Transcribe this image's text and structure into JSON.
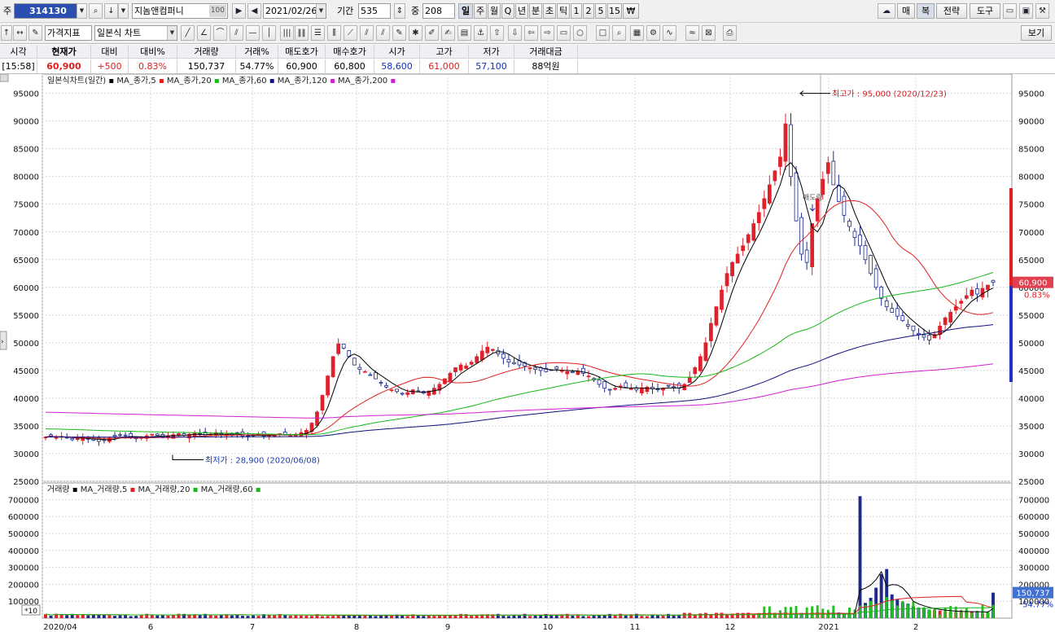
{
  "toolbar": {
    "code_prefix": "주",
    "stock_code": "314130",
    "stock_name": "지놈앤컴퍼니",
    "name_badge": "100",
    "date": "2021/02/26",
    "period_label": "기간",
    "period_value": "535",
    "zoom_label": "중",
    "zoom_value": "208",
    "periods": [
      "일",
      "주",
      "월",
      "Q",
      "년",
      "분",
      "초",
      "틱",
      "1",
      "2",
      "5",
      "15",
      "₩"
    ],
    "right_buttons": [
      "매",
      "복",
      "전략",
      "도구"
    ],
    "row2_dropdown1": "가격지표",
    "row2_dropdown2": "일본식 차트",
    "view_button": "보기"
  },
  "quote": {
    "headers": [
      "시각",
      "현재가",
      "대비",
      "대비%",
      "거래량",
      "거래%",
      "매도호가",
      "매수호가",
      "시가",
      "고가",
      "저가",
      "거래대금"
    ],
    "values": [
      "[15:58]",
      "60,900",
      "+500",
      "0.83%",
      "150,737",
      "54.77%",
      "60,900",
      "60,800",
      "58,600",
      "61,000",
      "57,100",
      "88억원"
    ]
  },
  "price_panel": {
    "legend_title": "일본식차트(일간)",
    "legend_items": [
      {
        "name": "MA_종가,5",
        "color": "#000000"
      },
      {
        "name": "MA_종가,20",
        "color": "#e02020"
      },
      {
        "name": "MA_종가,60",
        "color": "#18b818"
      },
      {
        "name": "MA_종가,120",
        "color": "#101080"
      },
      {
        "name": "MA_종가,200",
        "color": "#d020d0"
      }
    ],
    "high_annotation": "최고가 : 95,000 (2020/12/23)",
    "low_annotation": "최저가 : 28,900 (2020/06/08)",
    "mid_annotation": "매도량",
    "last_price_tag": "60,900",
    "last_change_tag": "0.83%"
  },
  "volume_panel": {
    "legend_title": "거래량",
    "legend_items": [
      {
        "name": "MA_거래량,5",
        "color": "#000000"
      },
      {
        "name": "MA_거래량,20",
        "color": "#e02020"
      },
      {
        "name": "MA_거래량,60",
        "color": "#18b818"
      }
    ],
    "scale_badge": "*10",
    "last_volume_tag": "150,737",
    "last_ratio_tag": "54.77%"
  },
  "x_axis_labels": [
    "2020/04",
    "6",
    "7",
    "8",
    "9",
    "10",
    "11",
    "12",
    "2021",
    "2"
  ],
  "chart_data": {
    "type": "candlestick",
    "title": "일본식차트(일간)",
    "price_ylim": [
      25000,
      97000
    ],
    "price_yticks": [
      25000,
      30000,
      35000,
      40000,
      45000,
      50000,
      55000,
      60000,
      65000,
      70000,
      75000,
      80000,
      85000,
      90000,
      95000
    ],
    "volume_ylim": [
      0,
      750000
    ],
    "volume_yticks": [
      100000,
      200000,
      300000,
      400000,
      500000,
      600000,
      700000
    ],
    "high": {
      "value": 95000,
      "date": "2020/12/23"
    },
    "low": {
      "value": 28900,
      "date": "2020/06/08"
    },
    "last_close": 60900,
    "close_series_approx": [
      33000,
      33200,
      32900,
      33100,
      32800,
      32500,
      32700,
      33000,
      32600,
      32400,
      32200,
      32500,
      32800,
      33100,
      33400,
      33200,
      32900,
      32700,
      32900,
      33200,
      33500,
      33300,
      33000,
      33100,
      33400,
      33600,
      33300,
      33500,
      33700,
      33400,
      33200,
      33500,
      33800,
      33600,
      33400,
      33300,
      33500,
      33200,
      33100,
      33300,
      33500,
      33200,
      33400,
      33300,
      33600,
      33400,
      33200,
      33500,
      33800,
      34200,
      35500,
      37500,
      40500,
      44000,
      47500,
      49800,
      49000,
      47500,
      46000,
      45200,
      44800,
      44200,
      43500,
      42800,
      42000,
      41500,
      41200,
      40800,
      41000,
      41500,
      41200,
      40900,
      41300,
      41800,
      42500,
      43500,
      44500,
      45500,
      46000,
      45800,
      46500,
      47500,
      48500,
      49200,
      48800,
      48000,
      47200,
      46500,
      46200,
      46000,
      45800,
      45500,
      45200,
      45000,
      44800,
      45100,
      45300,
      45000,
      44800,
      44600,
      44800,
      44500,
      44000,
      43300,
      42500,
      41800,
      41500,
      41800,
      42200,
      42000,
      41700,
      41500,
      41800,
      42000,
      41700,
      41500,
      41800,
      42200,
      42000,
      41800,
      42500,
      43800,
      45500,
      47500,
      50000,
      53500,
      56500,
      59500,
      62500,
      64500,
      66000,
      67500,
      69500,
      71500,
      73500,
      76000,
      78500,
      81000,
      83500,
      89500,
      80000,
      72000,
      66000,
      64500,
      71500,
      76000,
      79500,
      82500,
      78500,
      75500,
      73000,
      71000,
      69000,
      67500,
      65000,
      62500,
      60000,
      58000,
      56500,
      55500,
      54800,
      54000,
      53000,
      52200,
      51500,
      51000,
      50500,
      51500,
      53000,
      54500,
      55500,
      56500,
      57500,
      58500,
      59500,
      58800,
      59800,
      60400,
      60900
    ],
    "volume_series_approx_tail": [
      720000,
      90000,
      120000,
      180000,
      260000,
      290000,
      140000,
      110000,
      95000,
      85000,
      70000,
      60000,
      55000,
      50000,
      48000,
      45000,
      40000,
      38000,
      35000,
      40000,
      42000,
      38000,
      35000,
      30000,
      32000,
      150737
    ]
  }
}
